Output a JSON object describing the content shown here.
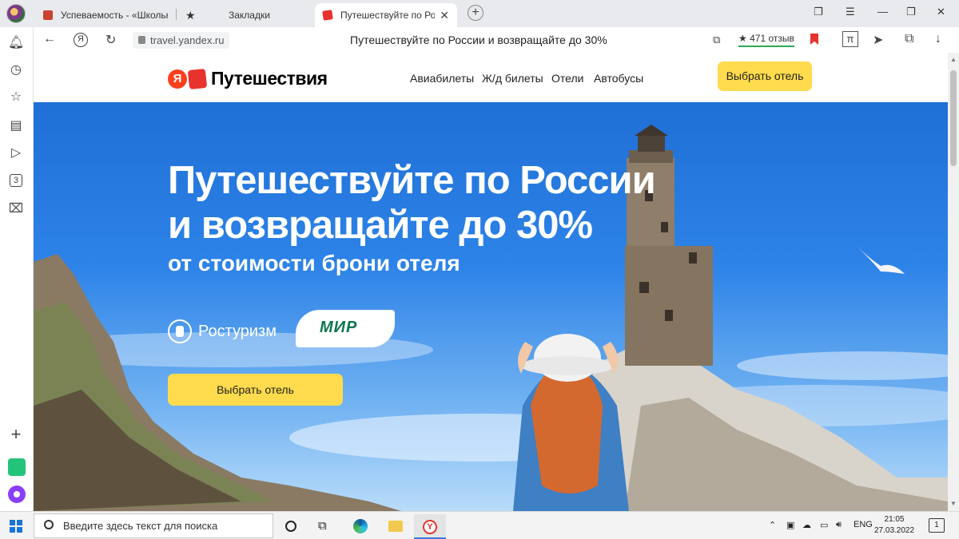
{
  "browser": {
    "tabs": [
      {
        "title": "Успеваемость - «Школьн",
        "closable": false
      },
      {
        "title": "Закладки",
        "closable": false
      },
      {
        "title": "Путешествуйте по Росс",
        "closable": true,
        "active": true
      }
    ],
    "close_glyph": "✕",
    "address": "travel.yandex.ru",
    "page_title": "Путешествуйте по России и возвращайте до 30%",
    "reviews": "★ 471 отзыв"
  },
  "site": {
    "logo_ya": "Я",
    "logo_name": "Путешествия",
    "nav": [
      "Авиабилеты",
      "Ж/д билеты",
      "Отели",
      "Автобусы"
    ],
    "header_button": "Выбрать отель"
  },
  "hero": {
    "title_line1": "Путешествуйте по России",
    "title_line2": "и возвращайте до 30%",
    "subtitle": "от стоимости брони отеля",
    "partner1": "Ростуризм",
    "partner2": "МИР",
    "button": "Выбрать отель"
  },
  "taskbar": {
    "search_placeholder": "Введите здесь текст для поиска",
    "lang": "ENG",
    "time": "21:05",
    "date": "27.03.2022",
    "notifications": "1"
  },
  "colors": {
    "accent_yellow": "#ffdb4d",
    "yandex_red": "#fc3f1d",
    "sky_blue": "#2d83e8",
    "mir_green": "#0f754e"
  }
}
